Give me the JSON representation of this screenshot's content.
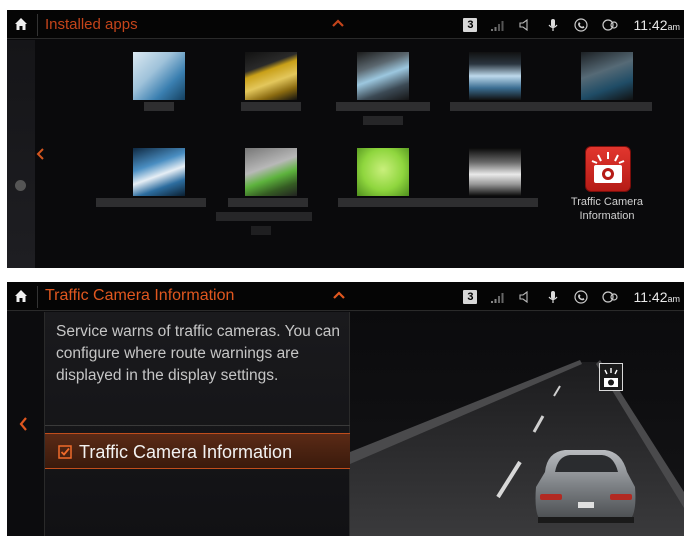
{
  "top_screen": {
    "title": "Installed apps",
    "status": {
      "badge": "3",
      "time": "11:42",
      "ampm": "am"
    },
    "apps": [
      {
        "tile": "blue"
      },
      {
        "tile": "yellow"
      },
      {
        "tile": "steel"
      },
      {
        "tile": "tower"
      },
      {
        "tile": "teal"
      },
      {
        "tile": "mail"
      },
      {
        "tile": "greyg"
      },
      {
        "tile": "green"
      },
      {
        "tile": "cloud"
      },
      {
        "tile": "camera",
        "label_line1": "Traffic Camera",
        "label_line2": "Information"
      }
    ]
  },
  "bottom_screen": {
    "title": "Traffic Camera Information",
    "status": {
      "badge": "3",
      "time": "11:42",
      "ampm": "am"
    },
    "description": "Service warns of traffic cameras. You can configure where route warnings are displayed in the display settings.",
    "option_label": "Traffic Camera Information",
    "option_checked": true
  },
  "colors": {
    "accent": "#e0571f",
    "background": "#0a0a0c",
    "highlight": "#c04d1c"
  },
  "icons": [
    "home-icon",
    "chevron-up-icon",
    "signal-icon",
    "speaker-icon",
    "microphone-icon",
    "phone-icon",
    "connection-icon",
    "chevron-left-icon",
    "checkbox-icon",
    "speed-camera-icon"
  ]
}
